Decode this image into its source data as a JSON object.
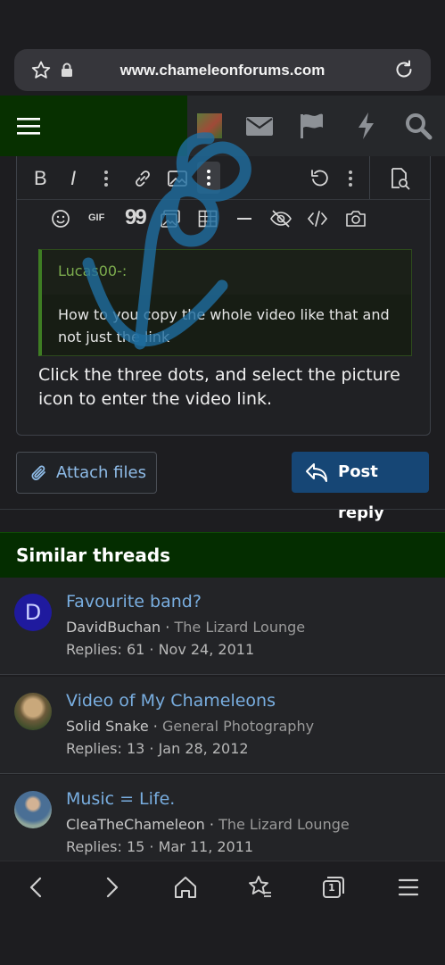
{
  "browser": {
    "url": "www.chameleonforums.com",
    "icons": [
      "star-icon",
      "lock-icon",
      "reload-icon"
    ]
  },
  "site_nav": {
    "icons": [
      "menu-icon",
      "avatar-icon",
      "mail-icon",
      "flag-icon",
      "bolt-icon",
      "search-icon"
    ],
    "colors": {
      "left_bg": "#073000",
      "bar_bg": "#26282b"
    }
  },
  "editor": {
    "toolbar_row1": [
      "bold-icon",
      "italic-icon",
      "more-icon",
      "link-icon",
      "image-icon",
      "more-vertical-icon",
      "undo-icon",
      "more-icon",
      "preview-icon"
    ],
    "toolbar_row1_labels": {
      "bold": "B",
      "italic": "I"
    },
    "toolbar_row2": [
      "smilie-icon",
      "gif-icon",
      "quote-icon",
      "media-icon",
      "table-icon",
      "hr-icon",
      "spoiler-icon",
      "code-icon",
      "camera-icon"
    ],
    "toolbar_row2_labels": {
      "gif": "GIF",
      "quote": "99"
    },
    "quote": {
      "author": "Lucas00-:",
      "body": "How to you copy the whole video like that and not just the link"
    },
    "reply_text": "Click the three dots, and select the picture icon to enter the video link."
  },
  "actions": {
    "attach_label": "Attach files",
    "post_label": "Post reply"
  },
  "similar_threads": {
    "title": "Similar threads",
    "items": [
      {
        "avatar_letter": "D",
        "title": "Favourite band?",
        "author": "DavidBuchan",
        "forum": "The Lizard Lounge",
        "stats": "Replies: 61 · Nov 24, 2011"
      },
      {
        "avatar_letter": "",
        "title": "Video of My Chameleons",
        "author": "Solid Snake",
        "forum": "General Photography",
        "stats": "Replies: 13 · Jan 28, 2012"
      },
      {
        "avatar_letter": "",
        "title": "Music = Life.",
        "author": "CleaTheChameleon",
        "forum": "The Lizard Lounge",
        "stats": "Replies: 15 · Mar 11, 2011"
      }
    ]
  },
  "bottom_nav": {
    "icons": [
      "back-icon",
      "forward-icon",
      "home-icon",
      "favorites-icon",
      "tabs-icon",
      "menu-icon"
    ],
    "tab_count": "1"
  }
}
